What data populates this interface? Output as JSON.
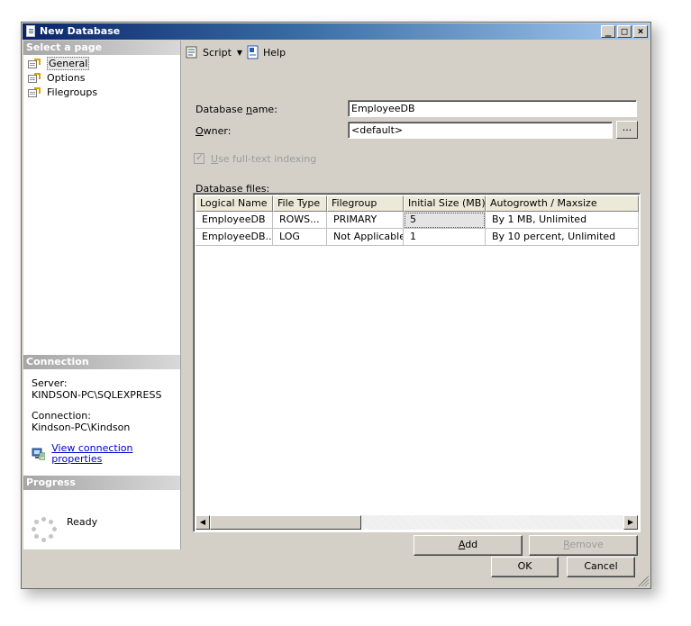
{
  "window": {
    "title": "New Database"
  },
  "left": {
    "select_page": "Select a page",
    "pages": [
      "General",
      "Options",
      "Filegroups"
    ],
    "connection_header": "Connection",
    "server_label": "Server:",
    "server_value": "KINDSON-PC\\SQLEXPRESS",
    "connection_label": "Connection:",
    "connection_value": "Kindson-PC\\Kindson",
    "view_link": "View connection properties",
    "progress_header": "Progress",
    "progress_status": "Ready"
  },
  "toolbar": {
    "script": "Script",
    "help": "Help"
  },
  "form": {
    "dbname_pre": "Database ",
    "dbname_u": "n",
    "dbname_post": "ame:",
    "dbname_value": "EmployeeDB",
    "owner_u": "O",
    "owner_post": "wner:",
    "owner_value": "<default>",
    "browse": "...",
    "fulltext_u": "U",
    "fulltext_post": "se full-text indexing",
    "dbfiles_pre": "Database ",
    "dbfiles_u": "f",
    "dbfiles_post": "iles:"
  },
  "grid": {
    "columns": [
      "Logical Name",
      "File Type",
      "Filegroup",
      "Initial Size (MB)",
      "Autogrowth / Maxsize"
    ],
    "rows": [
      [
        "EmployeeDB",
        "ROWS...",
        "PRIMARY",
        "5",
        "By 1 MB, Unlimited"
      ],
      [
        "EmployeeDB...",
        "LOG",
        "Not Applicable",
        "1",
        "By 10 percent, Unlimited"
      ]
    ]
  },
  "buttons": {
    "add_u": "A",
    "add_post": "dd",
    "remove_u": "R",
    "remove_post": "emove",
    "ok": "OK",
    "cancel": "Cancel"
  }
}
